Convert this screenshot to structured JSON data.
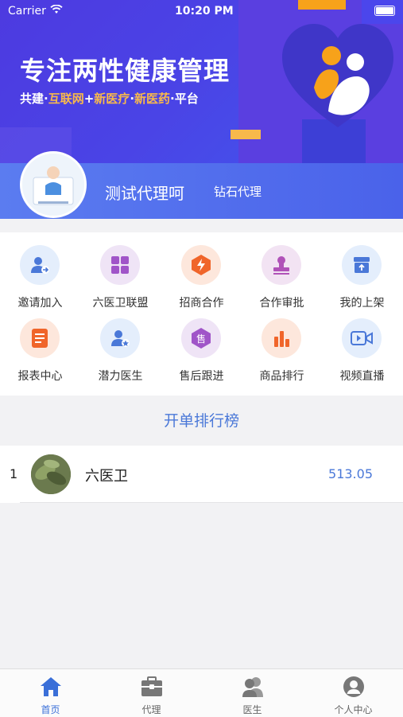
{
  "status_bar": {
    "carrier": "Carrier",
    "time": "10:20 PM"
  },
  "banner": {
    "title": "专注两性健康管理",
    "subtitle_parts": [
      "共建·",
      "互联网",
      "+",
      "新医疗",
      "·",
      "新医药",
      "·平台"
    ]
  },
  "profile": {
    "name": "测试代理呵",
    "level": "钻石代理"
  },
  "grid": [
    {
      "label": "邀请加入",
      "icon": "invite-user-icon",
      "bg": "#e4eefc",
      "fg": "#4a78d8"
    },
    {
      "label": "六医卫联盟",
      "icon": "alliance-grid-icon",
      "bg": "#efe4f6",
      "fg": "#a055c8"
    },
    {
      "label": "招商合作",
      "icon": "lightning-icon",
      "bg": "#fde7dc",
      "fg": "#f0652a"
    },
    {
      "label": "合作审批",
      "icon": "stamp-icon",
      "bg": "#f2e3f3",
      "fg": "#b052b8"
    },
    {
      "label": "我的上架",
      "icon": "shelf-box-icon",
      "bg": "#e4eefc",
      "fg": "#4a78d8"
    },
    {
      "label": "报表中心",
      "icon": "report-icon",
      "bg": "#fde7dc",
      "fg": "#f0652a"
    },
    {
      "label": "潜力医生",
      "icon": "doctor-star-icon",
      "bg": "#e4eefc",
      "fg": "#4a78d8"
    },
    {
      "label": "售后跟进",
      "icon": "after-sale-icon",
      "bg": "#efe4f6",
      "fg": "#a055c8"
    },
    {
      "label": "商品排行",
      "icon": "bar-chart-icon",
      "bg": "#fde7dc",
      "fg": "#f0652a"
    },
    {
      "label": "视频直播",
      "icon": "video-icon",
      "bg": "#e4eefc",
      "fg": "#4a78d8"
    }
  ],
  "ranking": {
    "title": "开单排行榜",
    "rows": [
      {
        "rank": "1",
        "name": "六医卫",
        "value": "513.05"
      }
    ]
  },
  "tabbar": [
    {
      "label": "首页",
      "icon": "home-icon",
      "active": true
    },
    {
      "label": "代理",
      "icon": "briefcase-icon",
      "active": false
    },
    {
      "label": "医生",
      "icon": "doctors-icon",
      "active": false
    },
    {
      "label": "个人中心",
      "icon": "profile-icon",
      "active": false
    }
  ],
  "colors": {
    "accent": "#3a6fd8",
    "banner": "#4a44e6",
    "highlight": "#f8b94b"
  }
}
